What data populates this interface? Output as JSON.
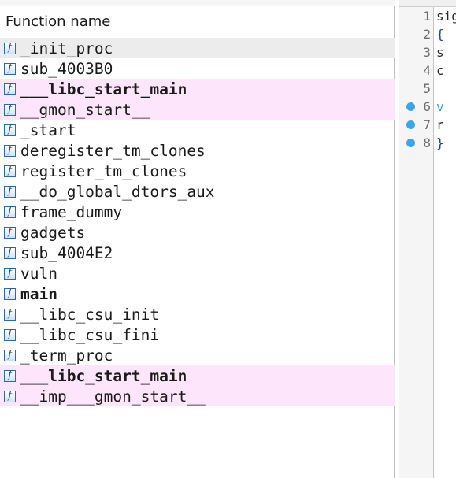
{
  "functions_panel": {
    "header": "Function name",
    "rows": [
      {
        "name": "_init_proc",
        "style": "sel"
      },
      {
        "name": "sub_4003B0",
        "style": ""
      },
      {
        "name": "___libc_start_main",
        "style": "lib bold"
      },
      {
        "name": "__gmon_start__",
        "style": "lib"
      },
      {
        "name": "_start",
        "style": ""
      },
      {
        "name": "deregister_tm_clones",
        "style": ""
      },
      {
        "name": "register_tm_clones",
        "style": ""
      },
      {
        "name": "__do_global_dtors_aux",
        "style": ""
      },
      {
        "name": "frame_dummy",
        "style": ""
      },
      {
        "name": "gadgets",
        "style": ""
      },
      {
        "name": "sub_4004E2",
        "style": ""
      },
      {
        "name": "vuln",
        "style": ""
      },
      {
        "name": "main",
        "style": "bold"
      },
      {
        "name": "__libc_csu_init",
        "style": ""
      },
      {
        "name": "__libc_csu_fini",
        "style": ""
      },
      {
        "name": "_term_proc",
        "style": ""
      },
      {
        "name": "___libc_start_main",
        "style": "lib bold"
      },
      {
        "name": "__imp___gmon_start__",
        "style": "lib"
      }
    ],
    "icon_glyph": "f",
    "icon_name": "function-icon"
  },
  "editor": {
    "lines": [
      {
        "num": "1",
        "code": "sig",
        "bp": false,
        "cls": ""
      },
      {
        "num": "2",
        "code": "{",
        "bp": false,
        "cls": "brace"
      },
      {
        "num": "3",
        "code": "  s",
        "bp": false,
        "cls": ""
      },
      {
        "num": "4",
        "code": "  c",
        "bp": false,
        "cls": ""
      },
      {
        "num": "5",
        "code": "",
        "bp": false,
        "cls": ""
      },
      {
        "num": "6",
        "code": "  v",
        "bp": true,
        "cls": "kw"
      },
      {
        "num": "7",
        "code": "  r",
        "bp": true,
        "cls": ""
      },
      {
        "num": "8",
        "code": "}",
        "bp": true,
        "cls": "brace"
      }
    ]
  },
  "colors": {
    "selected_row": "#ececec",
    "library_row": "#fde6fb",
    "breakpoint": "#38a6ea"
  }
}
